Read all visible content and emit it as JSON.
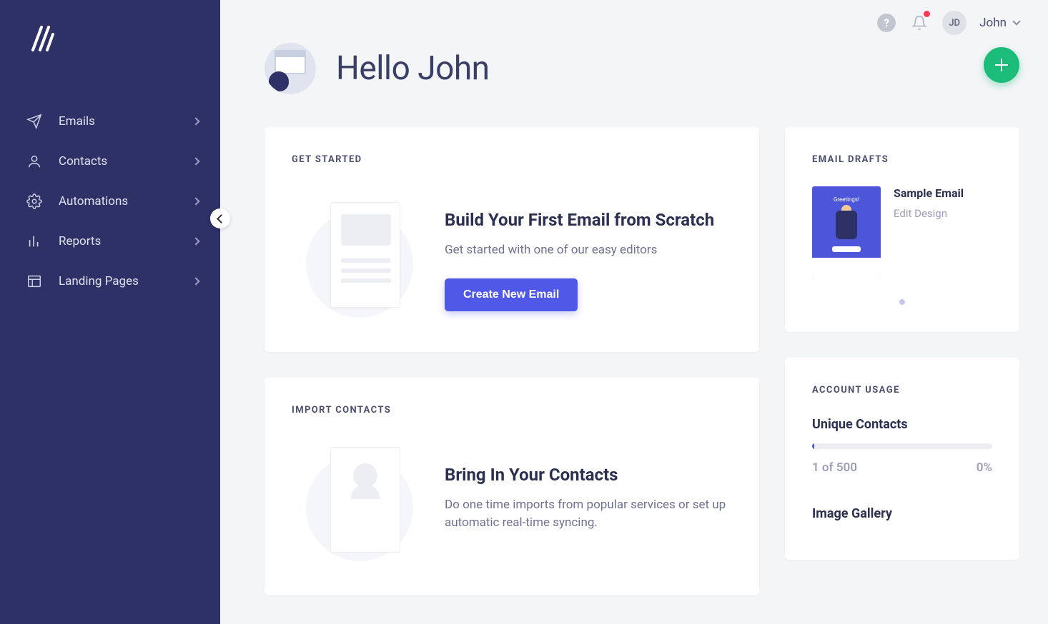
{
  "sidebar": {
    "items": [
      {
        "label": "Emails",
        "icon": "send-icon"
      },
      {
        "label": "Contacts",
        "icon": "person-icon"
      },
      {
        "label": "Automations",
        "icon": "gear-icon"
      },
      {
        "label": "Reports",
        "icon": "bars-icon"
      },
      {
        "label": "Landing Pages",
        "icon": "page-icon"
      }
    ]
  },
  "topbar": {
    "user_initials": "JD",
    "user_name": "John"
  },
  "greeting": {
    "title": "Hello John"
  },
  "get_started": {
    "header": "GET STARTED",
    "title": "Build Your First Email from Scratch",
    "subtitle": "Get started with one of our easy editors",
    "button": "Create New Email"
  },
  "import_contacts": {
    "header": "IMPORT CONTACTS",
    "title": "Bring In Your Contacts",
    "subtitle": "Do one time imports from popular services or set up automatic real-time syncing."
  },
  "drafts": {
    "header": "EMAIL DRAFTS",
    "items": [
      {
        "title": "Sample Email",
        "action": "Edit Design",
        "thumb_title": "Greetings!"
      }
    ]
  },
  "usage": {
    "header": "ACCOUNT USAGE",
    "contacts": {
      "label": "Unique Contacts",
      "stat": "1 of 500",
      "percent": "0%"
    },
    "gallery": {
      "label": "Image Gallery"
    }
  }
}
